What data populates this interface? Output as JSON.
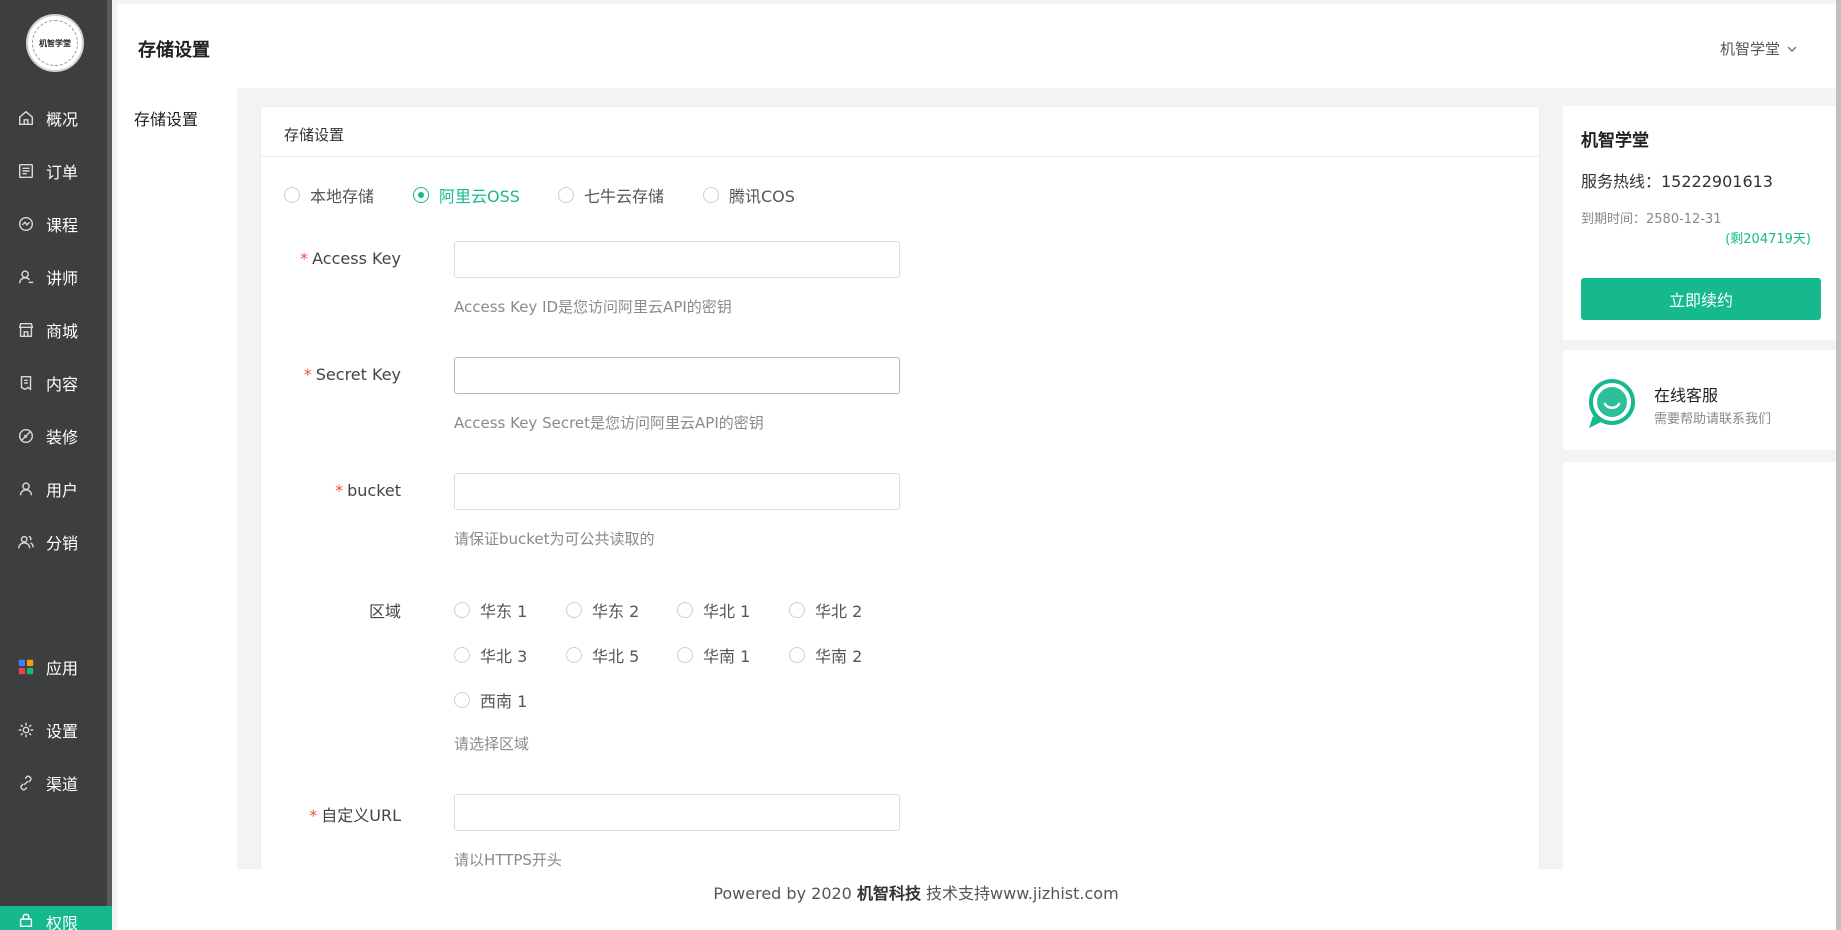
{
  "logo": {
    "text": "机智学堂"
  },
  "sidebar": {
    "items": [
      {
        "label": "概况",
        "icon": "home-icon"
      },
      {
        "label": "订单",
        "icon": "order-icon"
      },
      {
        "label": "课程",
        "icon": "course-icon"
      },
      {
        "label": "讲师",
        "icon": "teacher-icon"
      },
      {
        "label": "商城",
        "icon": "shop-icon"
      },
      {
        "label": "内容",
        "icon": "content-icon"
      },
      {
        "label": "装修",
        "icon": "decorate-icon"
      },
      {
        "label": "用户",
        "icon": "user-icon"
      },
      {
        "label": "分销",
        "icon": "distribution-icon"
      },
      {
        "label": "应用",
        "icon": "apps-icon"
      },
      {
        "label": "设置",
        "icon": "gear-icon"
      },
      {
        "label": "渠道",
        "icon": "link-icon"
      },
      {
        "label": "权限",
        "icon": "lock-icon"
      }
    ],
    "active_color": "#16b88e"
  },
  "header": {
    "title": "存储设置",
    "user": "机智学堂"
  },
  "subnav": {
    "item": "存储设置"
  },
  "card": {
    "title": "存储设置",
    "storage_options": [
      {
        "label": "本地存储",
        "checked": false
      },
      {
        "label": "阿里云OSS",
        "checked": true
      },
      {
        "label": "七牛云存储",
        "checked": false
      },
      {
        "label": "腾讯COS",
        "checked": false
      }
    ],
    "fields": {
      "access_key": {
        "label": "Access Key",
        "value": "",
        "hint": "Access Key ID是您访问阿里云API的密钥"
      },
      "secret_key": {
        "label": "Secret Key",
        "value": "",
        "hint": "Access Key Secret是您访问阿里云API的密钥"
      },
      "bucket": {
        "label": "bucket",
        "value": "",
        "hint": "请保证bucket为可公共读取的"
      },
      "region": {
        "label": "区域",
        "hint": "请选择区域",
        "options": [
          "华东 1",
          "华东 2",
          "华北 1",
          "华北 2",
          "华北 3",
          "华北 5",
          "华南 1",
          "华南 2",
          "西南 1"
        ]
      },
      "custom_url": {
        "label": "自定义URL",
        "value": "",
        "hint": "请以HTTPS开头"
      }
    }
  },
  "footer": {
    "prefix": "Powered by 2020 ",
    "brand": "机智科技",
    "suffix": " 技术支持www.jizhist.com"
  },
  "right_panel": {
    "title": "机智学堂",
    "hotline": "服务热线：15222901613",
    "expire": "到期时间：2580-12-31",
    "remain": "(剩204719天)",
    "renew_button": "立即续约",
    "service_title": "在线客服",
    "service_sub": "需要帮助请联系我们"
  },
  "colors": {
    "accent": "#16b88e",
    "sidebar_bg": "#3d3e3f",
    "required": "#e5533d"
  }
}
